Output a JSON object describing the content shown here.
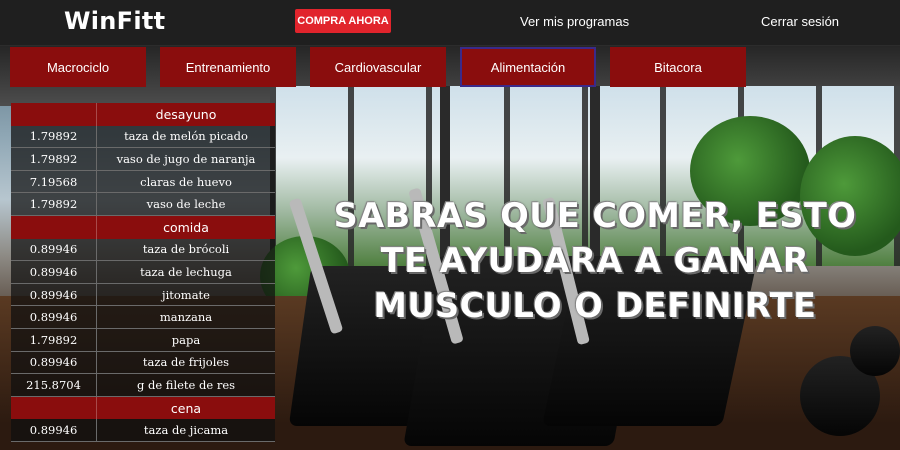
{
  "header": {
    "logo": "WinFitt",
    "buy_button": "COMPRA AHORA",
    "nav_programs": "Ver mis programas",
    "nav_logout": "Cerrar sesión"
  },
  "tabs": [
    {
      "label": "Macrociclo"
    },
    {
      "label": "Entrenamiento"
    },
    {
      "label": "Cardiovascular"
    },
    {
      "label": "Alimentación"
    },
    {
      "label": "Bitacora"
    }
  ],
  "active_tab": "Alimentación",
  "food_plan": {
    "desayuno": {
      "title": "desayuno",
      "items": [
        {
          "qty": "1.79892",
          "food": "taza de melón picado"
        },
        {
          "qty": "1.79892",
          "food": "vaso de jugo de naranja"
        },
        {
          "qty": "7.19568",
          "food": "claras de huevo"
        },
        {
          "qty": "1.79892",
          "food": "vaso de leche"
        }
      ]
    },
    "comida": {
      "title": "comida",
      "items": [
        {
          "qty": "0.89946",
          "food": "taza de brócoli"
        },
        {
          "qty": "0.89946",
          "food": "taza de lechuga"
        },
        {
          "qty": "0.89946",
          "food": "jitomate"
        },
        {
          "qty": "0.89946",
          "food": "manzana"
        },
        {
          "qty": "1.79892",
          "food": "papa"
        },
        {
          "qty": "0.89946",
          "food": "taza de frijoles"
        },
        {
          "qty": "215.8704",
          "food": "g de filete de res"
        }
      ]
    },
    "cena": {
      "title": "cena",
      "items": [
        {
          "qty": "0.89946",
          "food": "taza de jicama"
        }
      ]
    }
  },
  "hero": {
    "line1": "SABRAS QUE COMER, ESTO",
    "line2": "TE AYUDARA A GANAR",
    "line3": "MUSCULO O DEFINIRTE"
  },
  "colors": {
    "header_bg": "#1f1f1f",
    "accent_red": "#e1242c",
    "tab_red": "#8a0d0d",
    "active_tab_border": "#3a2a8a"
  }
}
